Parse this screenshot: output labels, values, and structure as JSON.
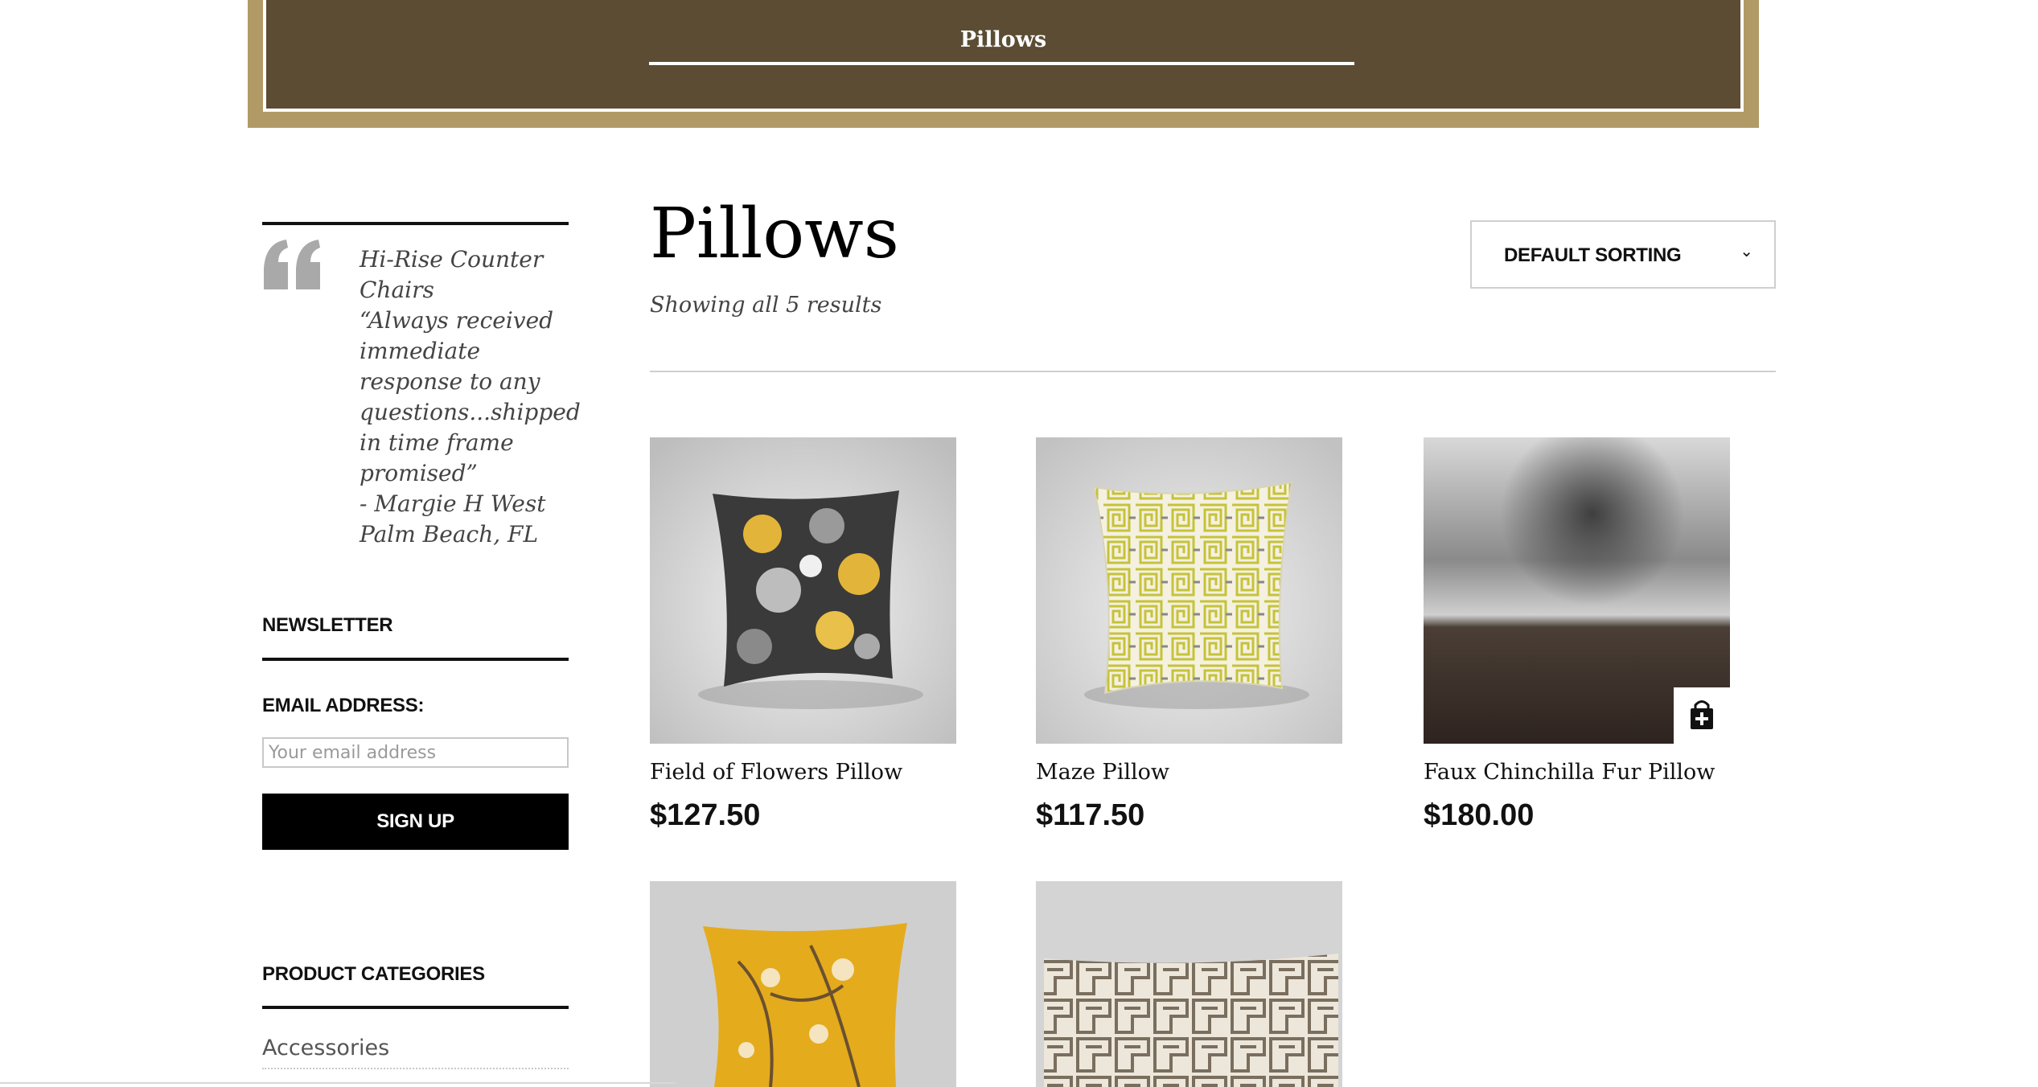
{
  "banner": {
    "title": "Pillows"
  },
  "sidebar": {
    "testimonial": {
      "text": "Hi-Rise Counter Chairs\n“Always received immediate response to any questions...shipped in time frame promised”\n- Margie H  West Palm Beach, FL"
    },
    "newsletter": {
      "title": "NEWSLETTER",
      "email_label": "EMAIL ADDRESS:",
      "email_placeholder": "Your email address",
      "signup_label": "SIGN UP"
    },
    "categories": {
      "title": "PRODUCT CATEGORIES",
      "items": [
        "Accessories"
      ]
    }
  },
  "main": {
    "title": "Pillows",
    "result_count": "Showing all 5 results",
    "sort": {
      "selected": "DEFAULT SORTING",
      "icon": "chevron-down-icon"
    },
    "products": [
      {
        "name": "Field of Flowers Pillow",
        "price": "$127.50"
      },
      {
        "name": "Maze Pillow",
        "price": "$117.50"
      },
      {
        "name": "Faux Chinchilla Fur Pillow",
        "price": "$180.00"
      },
      {
        "name": "",
        "price": ""
      },
      {
        "name": "",
        "price": ""
      }
    ]
  },
  "colors": {
    "banner_brown": "#5b4c33",
    "banner_gold": "#b19a66",
    "button_black": "#000000"
  }
}
